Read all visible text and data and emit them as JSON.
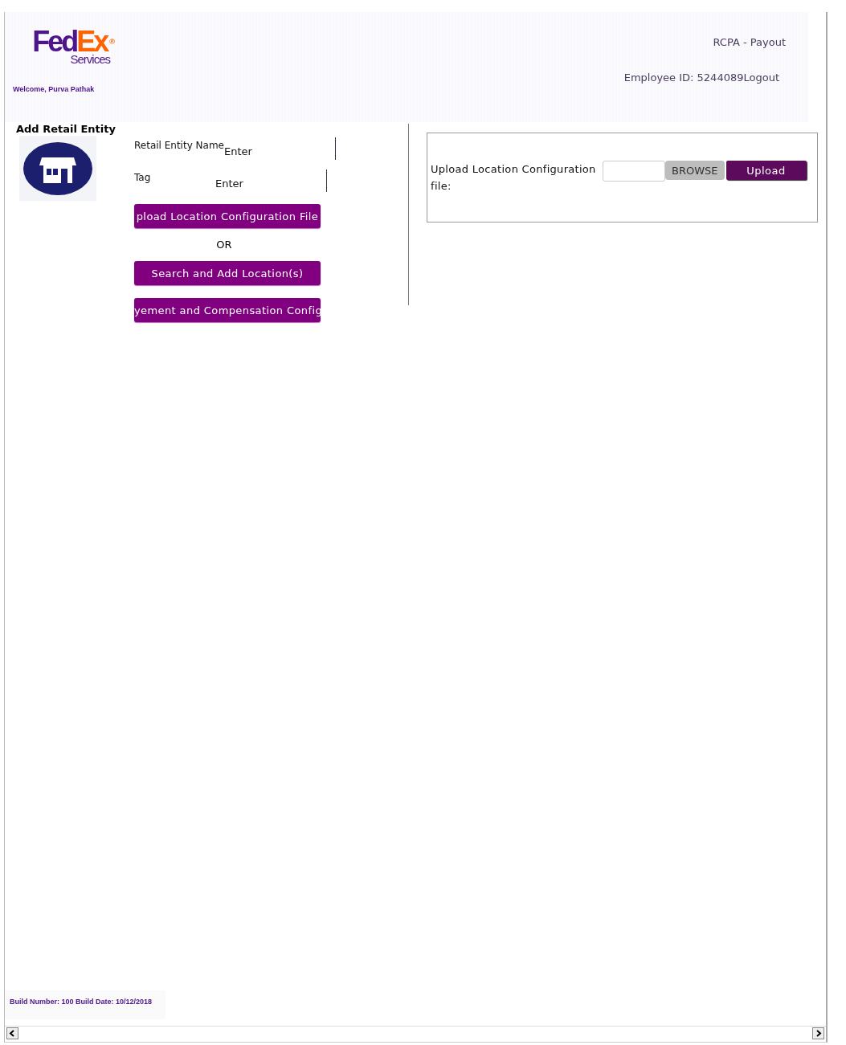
{
  "header": {
    "logo": {
      "fed": "Fed",
      "ex": "Ex",
      "mark": "®",
      "sub": "Services"
    },
    "welcome": "Welcome, Purva Pathak",
    "app_title": "RCPA - Payout",
    "employee": "Employee ID: 5244089",
    "logout": "Logout"
  },
  "entity_form": {
    "title": "Add Retail Entity",
    "fields": [
      {
        "label": "Retail Entity Name",
        "placeholder": "Enter"
      },
      {
        "label": "Tag",
        "placeholder": "Enter"
      }
    ],
    "actions": [
      {
        "kind": "button",
        "label": "pload Location Configuration File"
      },
      {
        "kind": "separator",
        "label": "OR"
      },
      {
        "kind": "button",
        "label": "Search and Add Location(s)"
      },
      {
        "kind": "button",
        "label": "yement and Compensation Config"
      }
    ]
  },
  "upload_panel": {
    "label": "Upload Location Configuration file:",
    "browse": "BROWSE",
    "upload": "Upload"
  },
  "footer": {
    "build": "Build Number: 100 Build Date: 10/12/2018"
  }
}
